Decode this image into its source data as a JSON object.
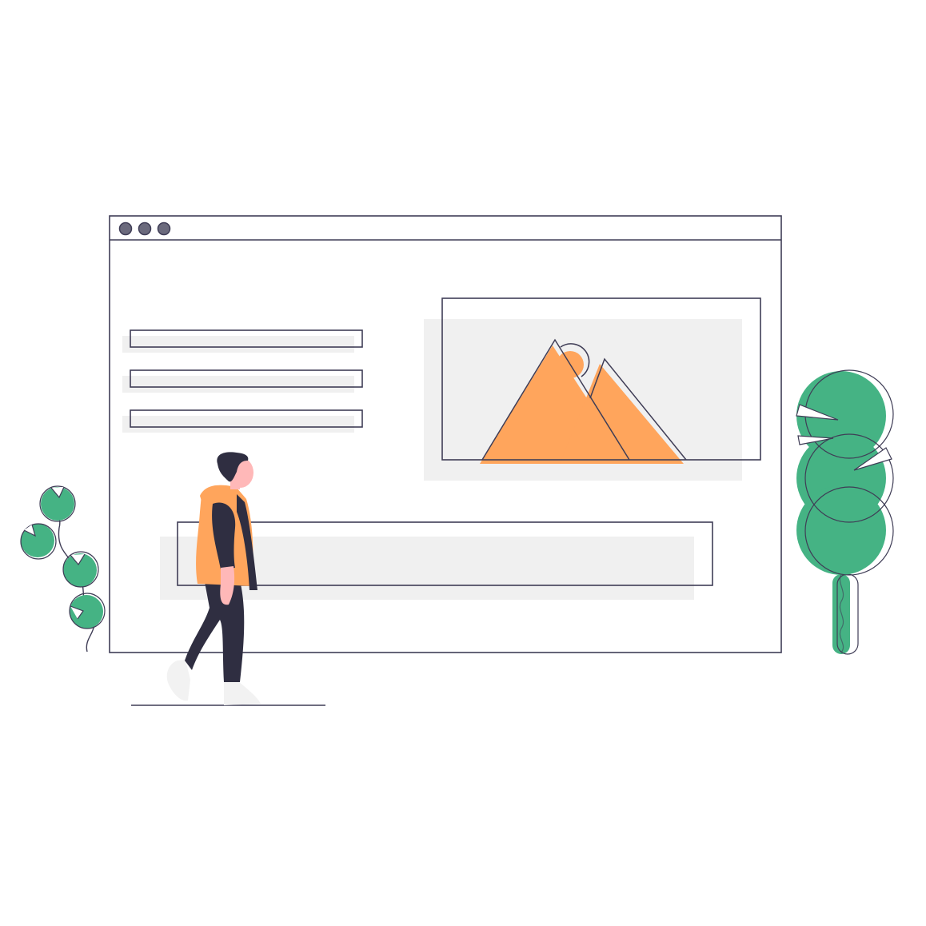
{
  "colors": {
    "background": "#ffffff",
    "outline": "#3f3d56",
    "placeholder_fill": "#f0f0f0",
    "accent_orange": "#ffa55c",
    "plant_green": "#45b384",
    "hair_dark": "#2f2e41",
    "skin": "#ffb8b8",
    "shoe": "#f2f2f2",
    "window_dot": "#6b6a7d"
  },
  "browser_window": {
    "controls": [
      "window-dot-icon",
      "window-dot-icon",
      "window-dot-icon"
    ],
    "text_field_count": 3
  },
  "image_placeholder": {
    "icon": "mountain-landscape-icon"
  },
  "decorations": {
    "left_plant": "leafy-vine-plant",
    "right_plant": "round-topiary-tree",
    "figure": "walking-person"
  }
}
